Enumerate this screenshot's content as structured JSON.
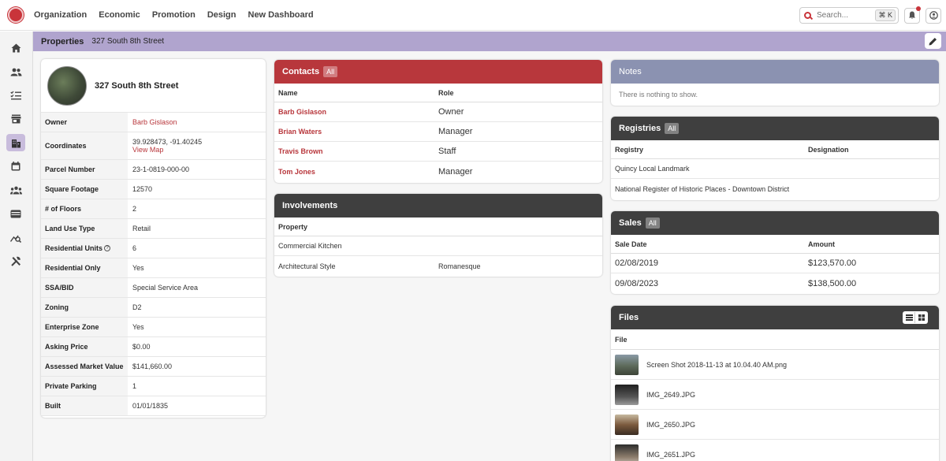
{
  "nav": {
    "links": [
      "Organization",
      "Economic",
      "Promotion",
      "Design",
      "New Dashboard"
    ],
    "search_placeholder": "Search...",
    "search_shortcut": "⌘ K"
  },
  "propbar": {
    "title": "Properties",
    "subtitle": "327 South 8th Street"
  },
  "property": {
    "title": "327 South 8th Street",
    "rows": [
      {
        "label": "Owner",
        "value": "Barb Gislason"
      },
      {
        "label": "Coordinates",
        "value": "39.928473, -91.40245",
        "link": "View Map"
      },
      {
        "label": "Parcel Number",
        "value": "23-1-0819-000-00"
      },
      {
        "label": "Square Footage",
        "value": "12570"
      },
      {
        "label": "# of Floors",
        "value": "2"
      },
      {
        "label": "Land Use Type",
        "value": "Retail"
      },
      {
        "label": "Residential Units",
        "value": "6"
      },
      {
        "label": "Residential Only",
        "value": "Yes"
      },
      {
        "label": "SSA/BID",
        "value": "Special Service Area"
      },
      {
        "label": "Zoning",
        "value": "D2"
      },
      {
        "label": "Enterprise Zone",
        "value": "Yes"
      },
      {
        "label": "Asking Price",
        "value": "$0.00"
      },
      {
        "label": "Assessed Market Value",
        "value": "$141,660.00"
      },
      {
        "label": "Private Parking",
        "value": "1"
      },
      {
        "label": "Built",
        "value": "01/01/1835"
      }
    ]
  },
  "contacts": {
    "title": "Contacts",
    "pill": "All",
    "col_name": "Name",
    "col_role": "Role",
    "rows": [
      {
        "name": "Barb Gislason",
        "role": "Owner"
      },
      {
        "name": "Brian Waters",
        "role": "Manager"
      },
      {
        "name": "Travis Brown",
        "role": "Staff"
      },
      {
        "name": "Tom Jones",
        "role": "Manager"
      }
    ]
  },
  "involvements": {
    "title": "Involvements",
    "col_property": "Property",
    "rows": [
      {
        "property": "Commercial Kitchen",
        "value": ""
      },
      {
        "property": "Architectural Style",
        "value": "Romanesque"
      }
    ]
  },
  "notes": {
    "title": "Notes",
    "empty": "There is nothing to show."
  },
  "registries": {
    "title": "Registries",
    "pill": "All",
    "col_registry": "Registry",
    "col_designation": "Designation",
    "rows": [
      {
        "registry": "Quincy Local Landmark",
        "designation": ""
      },
      {
        "registry": "National Register of Historic Places - Downtown District",
        "designation": ""
      }
    ]
  },
  "sales": {
    "title": "Sales",
    "pill": "All",
    "col_date": "Sale Date",
    "col_amount": "Amount",
    "rows": [
      {
        "date": "02/08/2019",
        "amount": "$123,570.00"
      },
      {
        "date": "09/08/2023",
        "amount": "$138,500.00"
      }
    ]
  },
  "files": {
    "title": "Files",
    "col_file": "File",
    "rows": [
      {
        "name": "Screen Shot 2018-11-13 at 10.04.40 AM.png"
      },
      {
        "name": "IMG_2649.JPG"
      },
      {
        "name": "IMG_2650.JPG"
      },
      {
        "name": "IMG_2651.JPG"
      }
    ]
  },
  "colors": {
    "accent": "#b8373c",
    "propbar": "#b0a4ce",
    "dark_header": "#3f3f3f",
    "notes_header": "#8b92b1"
  }
}
